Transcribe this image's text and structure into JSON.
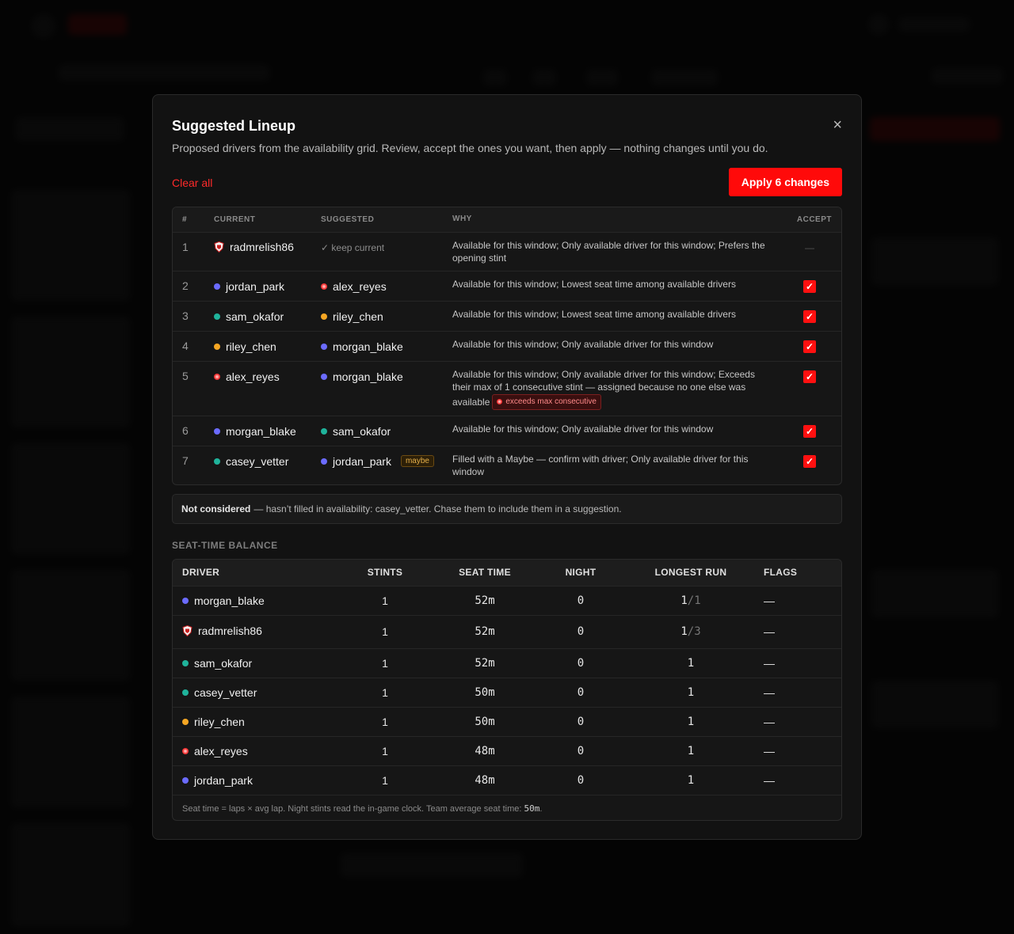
{
  "modal": {
    "title": "Suggested Lineup",
    "subtitle": "Proposed drivers from the availability grid. Review, accept the ones you want, then apply — nothing changes until you do.",
    "clear_all": "Clear all",
    "apply": "Apply 6 changes",
    "close": "×"
  },
  "lineup": {
    "headers": {
      "num": "#",
      "current": "CURRENT",
      "suggested": "SUGGESTED",
      "why": "WHY",
      "accept": "ACCEPT"
    },
    "keep_current": "✓ keep current",
    "rows": [
      {
        "num": "1",
        "current": "radmrelish86",
        "suggested": "",
        "why": "Available for this window; Only available driver for this window; Prefers the opening stint",
        "accept": "—"
      },
      {
        "num": "2",
        "current": "jordan_park",
        "suggested": "alex_reyes",
        "why": "Available for this window; Lowest seat time among available drivers",
        "accept": "✓"
      },
      {
        "num": "3",
        "current": "sam_okafor",
        "suggested": "riley_chen",
        "why": "Available for this window; Lowest seat time among available drivers",
        "accept": "✓"
      },
      {
        "num": "4",
        "current": "riley_chen",
        "suggested": "morgan_blake",
        "why": "Available for this window; Only available driver for this window",
        "accept": "✓"
      },
      {
        "num": "5",
        "current": "alex_reyes",
        "suggested": "morgan_blake",
        "why": "Available for this window; Only available driver for this window; Exceeds their max of 1 consecutive stint — assigned because no one else was available",
        "tag": "exceeds max consecutive",
        "accept": "✓"
      },
      {
        "num": "6",
        "current": "morgan_blake",
        "suggested": "sam_okafor",
        "why": "Available for this window; Only available driver for this window",
        "accept": "✓"
      },
      {
        "num": "7",
        "current": "casey_vetter",
        "suggested": "jordan_park",
        "suggested_tag": "maybe",
        "why": "Filled with a Maybe — confirm with driver; Only available driver for this window",
        "accept": "✓"
      }
    ]
  },
  "notice": {
    "bold": "Not considered",
    "text": "— hasn’t filled in availability: casey_vetter. Chase them to include them in a suggestion."
  },
  "balance": {
    "section_title": "SEAT-TIME BALANCE",
    "headers": {
      "driver": "DRIVER",
      "stints": "STINTS",
      "seat_time": "SEAT TIME",
      "night": "NIGHT",
      "longest_run": "LONGEST RUN",
      "flags": "FLAGS"
    },
    "rows": [
      {
        "driver": "morgan_blake",
        "stints": "1",
        "seat_time": "52m",
        "night": "0",
        "longest_run": "1",
        "run_max": "/1",
        "flags": "—"
      },
      {
        "driver": "radmrelish86",
        "stints": "1",
        "seat_time": "52m",
        "night": "0",
        "longest_run": "1",
        "run_max": "/3",
        "flags": "—"
      },
      {
        "driver": "sam_okafor",
        "stints": "1",
        "seat_time": "52m",
        "night": "0",
        "longest_run": "1",
        "flags": "—"
      },
      {
        "driver": "casey_vetter",
        "stints": "1",
        "seat_time": "50m",
        "night": "0",
        "longest_run": "1",
        "flags": "—"
      },
      {
        "driver": "riley_chen",
        "stints": "1",
        "seat_time": "50m",
        "night": "0",
        "longest_run": "1",
        "flags": "—"
      },
      {
        "driver": "alex_reyes",
        "stints": "1",
        "seat_time": "48m",
        "night": "0",
        "longest_run": "1",
        "flags": "—"
      },
      {
        "driver": "jordan_park",
        "stints": "1",
        "seat_time": "48m",
        "night": "0",
        "longest_run": "1",
        "flags": "—"
      }
    ],
    "footnote": "Seat time = laps × avg lap. Night stints read the in-game clock. Team average seat time:",
    "footnote_value": "50m",
    "footnote_end": "."
  },
  "colors": {
    "accent": "#ff0a0a",
    "jordan_park": "#6b6bff",
    "morgan_blake": "#6b6bff",
    "sam_okafor": "#1fb39b",
    "casey_vetter": "#1fb39b",
    "riley_chen": "#f5a623",
    "alex_reyes": "#ff3b3b"
  }
}
